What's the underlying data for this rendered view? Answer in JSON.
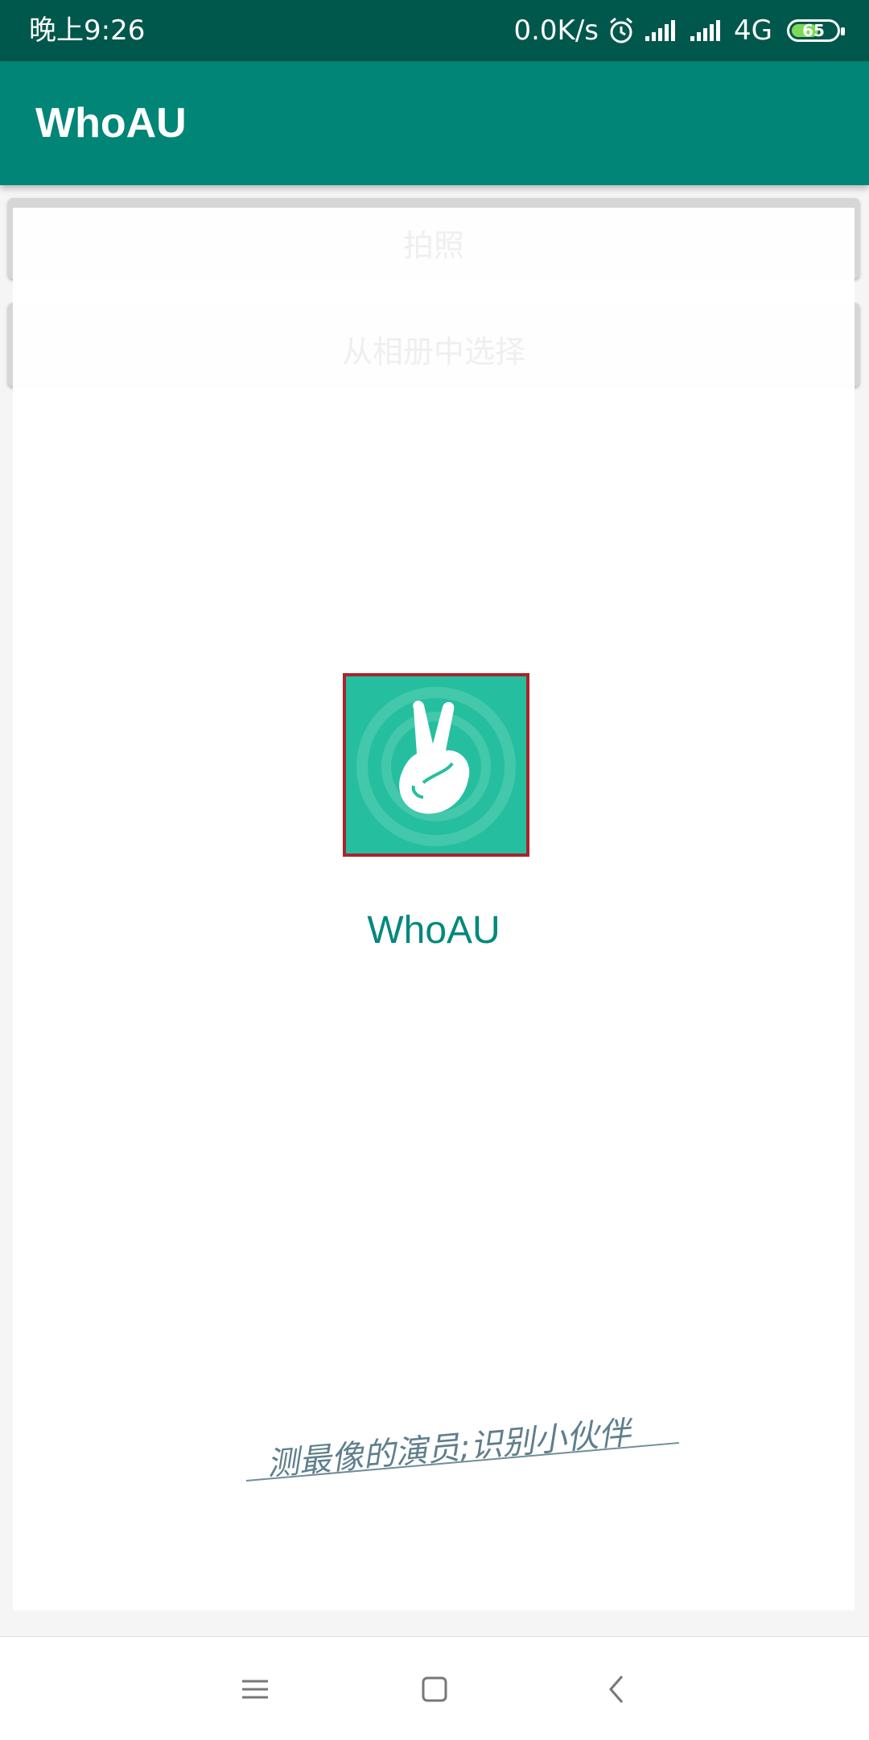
{
  "status_bar": {
    "time": "晚上9:26",
    "speed": "0.0K/s",
    "network": "4G",
    "battery_level": "65",
    "battery_fraction": 0.65
  },
  "app_bar": {
    "title": "WhoAU"
  },
  "actions": {
    "camera_label": "拍照",
    "album_label": "从相册中选择"
  },
  "splash": {
    "app_name": "WhoAU",
    "slogan": "测最像的演员;识别小伙伴",
    "logo_icon": "victory-hand-icon"
  },
  "nav_bar": {
    "icons": [
      "menu-icon",
      "home-icon",
      "back-icon"
    ]
  },
  "colors": {
    "status_bar": "#00574b",
    "app_bar": "#008577",
    "accent_text": "#00897b",
    "logo_bg": "#25bf9f",
    "logo_border": "#a8252c"
  }
}
